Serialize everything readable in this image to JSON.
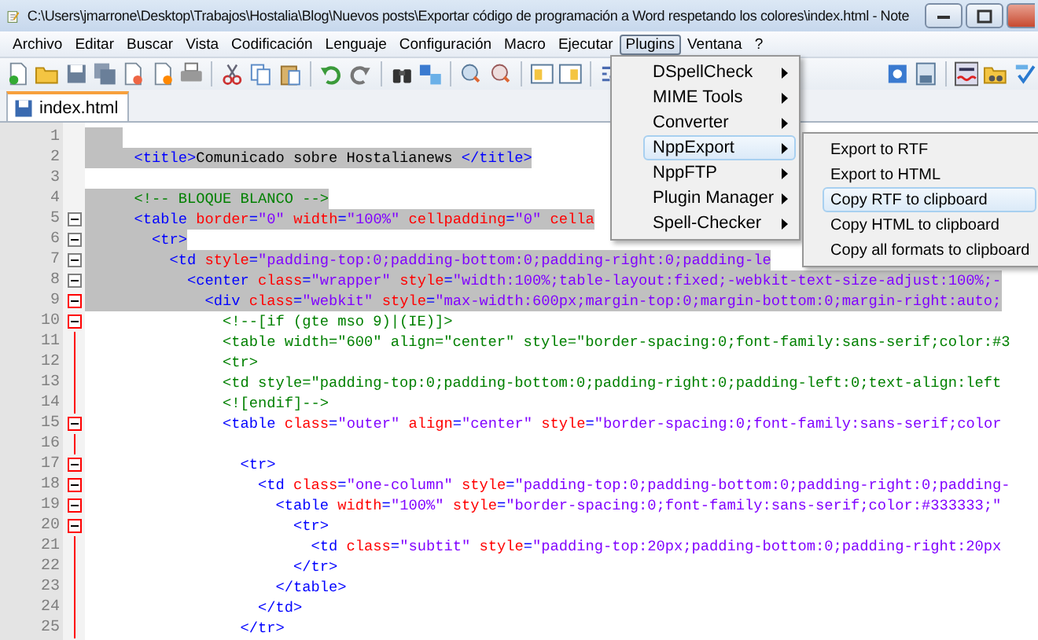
{
  "window": {
    "title": "C:\\Users\\jmarrone\\Desktop\\Trabajos\\Hostalia\\Blog\\Nuevos posts\\Exportar código de programación a Word respetando los colores\\index.html - Note"
  },
  "menu_bar": [
    {
      "label": "Archivo",
      "selected": false
    },
    {
      "label": "Editar",
      "selected": false
    },
    {
      "label": "Buscar",
      "selected": false
    },
    {
      "label": "Vista",
      "selected": false
    },
    {
      "label": "Codificación",
      "selected": false
    },
    {
      "label": "Lenguaje",
      "selected": false
    },
    {
      "label": "Configuración",
      "selected": false
    },
    {
      "label": "Macro",
      "selected": false
    },
    {
      "label": "Ejecutar",
      "selected": false
    },
    {
      "label": "Plugins",
      "selected": true
    },
    {
      "label": "Ventana",
      "selected": false
    },
    {
      "label": "?",
      "selected": false
    }
  ],
  "tabs": [
    {
      "label": "index.html",
      "selected": true
    }
  ],
  "plugins_menu": [
    {
      "label": "DSpellCheck",
      "selected": false
    },
    {
      "label": "MIME Tools",
      "selected": false
    },
    {
      "label": "Converter",
      "selected": false
    },
    {
      "label": "NppExport",
      "selected": true
    },
    {
      "label": "NppFTP",
      "selected": false
    },
    {
      "label": "Plugin Manager",
      "selected": false
    },
    {
      "label": "Spell-Checker",
      "selected": false
    }
  ],
  "nppexport_submenu": [
    {
      "label": "Export to RTF",
      "selected": false
    },
    {
      "label": "Export to HTML",
      "selected": false
    },
    {
      "label": "Copy RTF to clipboard",
      "selected": true
    },
    {
      "label": "Copy HTML to clipboard",
      "selected": false
    },
    {
      "label": "Copy all formats to clipboard",
      "selected": false
    }
  ],
  "editor": {
    "lines": [
      {
        "number": "1",
        "selected": true
      },
      {
        "number": "2",
        "selected": true,
        "tokens": [
          {
            "kind": "tag",
            "text": "  <title>"
          },
          {
            "kind": "text",
            "text": "Comunicado sobre Hostalianews "
          },
          {
            "kind": "tag",
            "text": "</title>"
          }
        ]
      },
      {
        "number": "3",
        "selected": false
      },
      {
        "number": "4",
        "selected": true,
        "tokens": [
          {
            "kind": "comment",
            "text": "  <!-- BLOQUE BLANCO -->"
          }
        ]
      },
      {
        "number": "5",
        "selected": true,
        "fold": {
          "kind": "box",
          "active": false
        },
        "tokens": [
          {
            "kind": "tag",
            "text": "  <table"
          },
          {
            "kind": "attr",
            "text": " border"
          },
          {
            "kind": "tag",
            "text": "="
          },
          {
            "kind": "value",
            "text": "\"0\""
          },
          {
            "kind": "attr",
            "text": " width"
          },
          {
            "kind": "tag",
            "text": "="
          },
          {
            "kind": "value",
            "text": "\"100%\""
          },
          {
            "kind": "attr",
            "text": " cellpadding"
          },
          {
            "kind": "tag",
            "text": "="
          },
          {
            "kind": "value",
            "text": "\"0\""
          },
          {
            "kind": "attr",
            "text": " cella"
          }
        ]
      },
      {
        "number": "6",
        "selected": true,
        "fold": {
          "kind": "box",
          "active": false
        },
        "tokens": [
          {
            "kind": "tag",
            "text": "    <tr>"
          }
        ]
      },
      {
        "number": "7",
        "selected": true,
        "fold": {
          "kind": "box",
          "active": false
        },
        "tokens": [
          {
            "kind": "tag",
            "text": "      <td"
          },
          {
            "kind": "attr",
            "text": " style"
          },
          {
            "kind": "tag",
            "text": "="
          },
          {
            "kind": "value",
            "text": "\"padding-top:0;padding-bottom:0;padding-right:0;padding-le"
          }
        ]
      },
      {
        "number": "8",
        "selected": true,
        "fold": {
          "kind": "box",
          "active": false
        },
        "tokens": [
          {
            "kind": "tag",
            "text": "        <center"
          },
          {
            "kind": "attr",
            "text": " class"
          },
          {
            "kind": "tag",
            "text": "="
          },
          {
            "kind": "value",
            "text": "\"wrapper\""
          },
          {
            "kind": "attr",
            "text": " style"
          },
          {
            "kind": "tag",
            "text": "="
          },
          {
            "kind": "value",
            "text": "\"width:100%;table-layout:fixed;-webkit-text-size-adjust:100%;-"
          }
        ]
      },
      {
        "number": "9",
        "selected": true,
        "fold": {
          "kind": "box",
          "active": true
        },
        "tokens": [
          {
            "kind": "tag",
            "text": "          <div"
          },
          {
            "kind": "attr",
            "text": " class"
          },
          {
            "kind": "tag",
            "text": "="
          },
          {
            "kind": "value",
            "text": "\"webkit\""
          },
          {
            "kind": "attr",
            "text": " style"
          },
          {
            "kind": "tag",
            "text": "="
          },
          {
            "kind": "value",
            "text": "\"max-width:600px;margin-top:0;margin-bottom:0;margin-right:auto;"
          }
        ]
      },
      {
        "number": "10",
        "selected": false,
        "fold": {
          "kind": "box",
          "active": true
        },
        "tokens": [
          {
            "kind": "comment",
            "text": "            <!--[if (gte mso 9)|(IE)]>"
          }
        ]
      },
      {
        "number": "11",
        "selected": false,
        "fold": {
          "kind": "line",
          "active": true
        },
        "tokens": [
          {
            "kind": "comment",
            "text": "            <table width=\"600\" align=\"center\" style=\"border-spacing:0;font-family:sans-serif;color:#3"
          }
        ]
      },
      {
        "number": "12",
        "selected": false,
        "fold": {
          "kind": "line",
          "active": true
        },
        "tokens": [
          {
            "kind": "comment",
            "text": "            <tr>"
          }
        ]
      },
      {
        "number": "13",
        "selected": false,
        "fold": {
          "kind": "line",
          "active": true
        },
        "tokens": [
          {
            "kind": "comment",
            "text": "            <td style=\"padding-top:0;padding-bottom:0;padding-right:0;padding-left:0;text-align:left"
          }
        ]
      },
      {
        "number": "14",
        "selected": false,
        "fold": {
          "kind": "line",
          "active": true
        },
        "tokens": [
          {
            "kind": "comment",
            "text": "            <![endif]-->"
          }
        ]
      },
      {
        "number": "15",
        "selected": false,
        "fold": {
          "kind": "box",
          "active": true
        },
        "tokens": [
          {
            "kind": "tag",
            "text": "            <table"
          },
          {
            "kind": "attr",
            "text": " class"
          },
          {
            "kind": "tag",
            "text": "="
          },
          {
            "kind": "value",
            "text": "\"outer\""
          },
          {
            "kind": "attr",
            "text": " align"
          },
          {
            "kind": "tag",
            "text": "="
          },
          {
            "kind": "value",
            "text": "\"center\""
          },
          {
            "kind": "attr",
            "text": " style"
          },
          {
            "kind": "tag",
            "text": "="
          },
          {
            "kind": "value",
            "text": "\"border-spacing:0;font-family:sans-serif;color"
          }
        ]
      },
      {
        "number": "16",
        "selected": false,
        "fold": {
          "kind": "line",
          "active": true
        }
      },
      {
        "number": "17",
        "selected": false,
        "fold": {
          "kind": "box",
          "active": true
        },
        "tokens": [
          {
            "kind": "tag",
            "text": "              <tr>"
          }
        ]
      },
      {
        "number": "18",
        "selected": false,
        "fold": {
          "kind": "box",
          "active": true
        },
        "tokens": [
          {
            "kind": "tag",
            "text": "                <td"
          },
          {
            "kind": "attr",
            "text": " class"
          },
          {
            "kind": "tag",
            "text": "="
          },
          {
            "kind": "value",
            "text": "\"one-column\""
          },
          {
            "kind": "attr",
            "text": " style"
          },
          {
            "kind": "tag",
            "text": "="
          },
          {
            "kind": "value",
            "text": "\"padding-top:0;padding-bottom:0;padding-right:0;padding-"
          }
        ]
      },
      {
        "number": "19",
        "selected": false,
        "fold": {
          "kind": "box",
          "active": true
        },
        "tokens": [
          {
            "kind": "tag",
            "text": "                  <table"
          },
          {
            "kind": "attr",
            "text": " width"
          },
          {
            "kind": "tag",
            "text": "="
          },
          {
            "kind": "value",
            "text": "\"100%\""
          },
          {
            "kind": "attr",
            "text": " style"
          },
          {
            "kind": "tag",
            "text": "="
          },
          {
            "kind": "value",
            "text": "\"border-spacing:0;font-family:sans-serif;color:#333333;\""
          }
        ]
      },
      {
        "number": "20",
        "selected": false,
        "fold": {
          "kind": "box",
          "active": true
        },
        "tokens": [
          {
            "kind": "tag",
            "text": "                    <tr>"
          }
        ]
      },
      {
        "number": "21",
        "selected": false,
        "fold": {
          "kind": "line",
          "active": true
        },
        "tokens": [
          {
            "kind": "tag",
            "text": "                      <td"
          },
          {
            "kind": "attr",
            "text": " class"
          },
          {
            "kind": "tag",
            "text": "="
          },
          {
            "kind": "value",
            "text": "\"subtit\""
          },
          {
            "kind": "attr",
            "text": " style"
          },
          {
            "kind": "tag",
            "text": "="
          },
          {
            "kind": "value",
            "text": "\"padding-top:20px;padding-bottom:0;padding-right:20px"
          }
        ]
      },
      {
        "number": "22",
        "selected": false,
        "fold": {
          "kind": "line",
          "active": true
        },
        "tokens": [
          {
            "kind": "tag",
            "text": "                    </tr>"
          }
        ]
      },
      {
        "number": "23",
        "selected": false,
        "fold": {
          "kind": "line",
          "active": true
        },
        "tokens": [
          {
            "kind": "tag",
            "text": "                  </table>"
          }
        ]
      },
      {
        "number": "24",
        "selected": false,
        "fold": {
          "kind": "line",
          "active": true
        },
        "tokens": [
          {
            "kind": "tag",
            "text": "                </td>"
          }
        ]
      },
      {
        "number": "25",
        "selected": false,
        "fold": {
          "kind": "line",
          "active": true
        },
        "tokens": [
          {
            "kind": "tag",
            "text": "              </tr>"
          }
        ]
      }
    ]
  }
}
